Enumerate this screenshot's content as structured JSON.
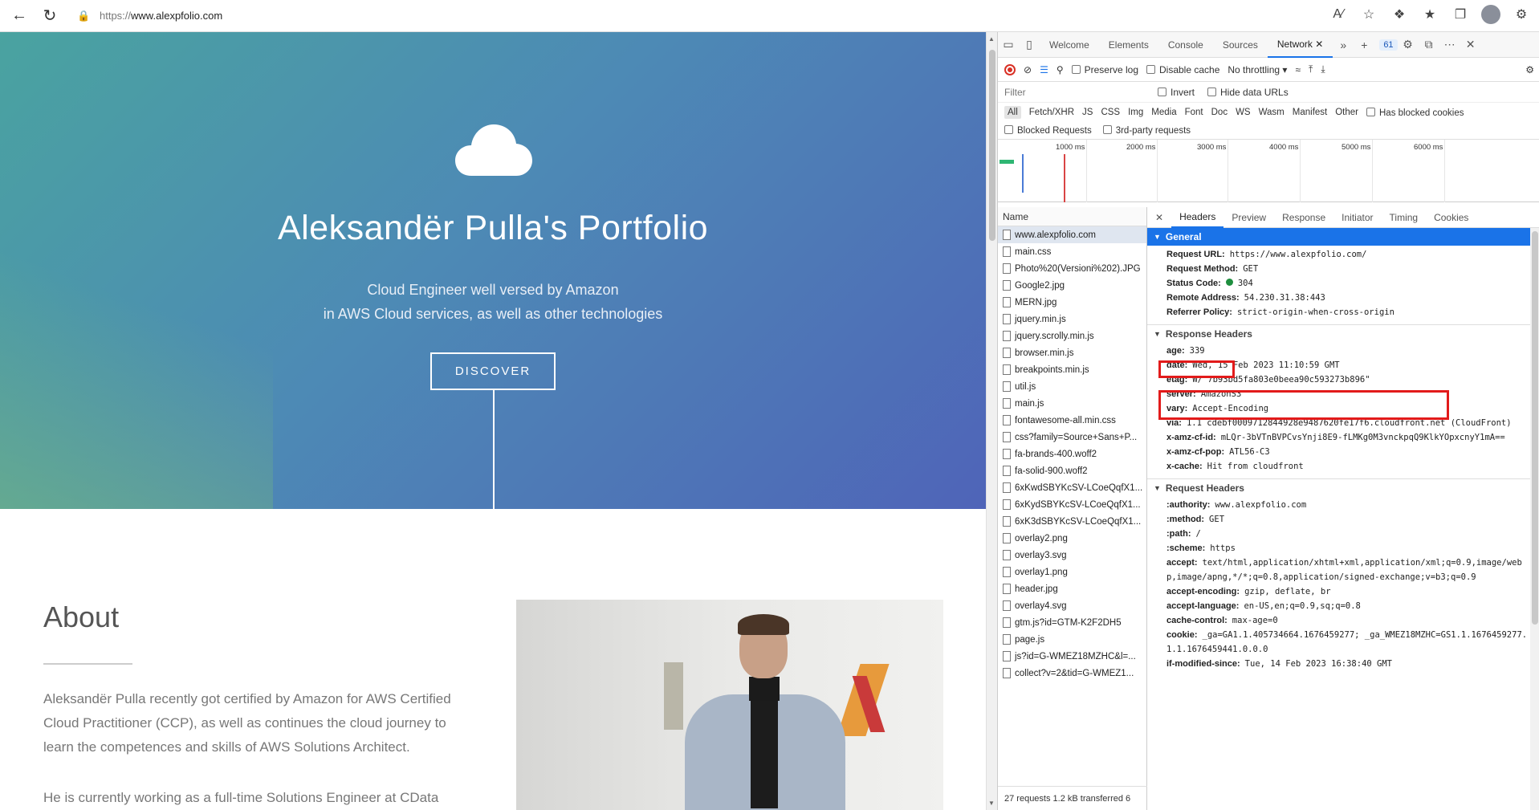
{
  "browser": {
    "url_prefix": "https://",
    "url_host": "www.alexpfolio.com"
  },
  "site": {
    "hero_title": "Aleksandër Pulla's Portfolio",
    "hero_sub_1": "Cloud Engineer well versed by Amazon",
    "hero_sub_2": "in AWS Cloud services, as well as other technologies",
    "discover_label": "DISCOVER",
    "about_title": "About",
    "about_p1": "Aleksandër Pulla recently got certified by Amazon for AWS Certified Cloud Practitioner (CCP), as well as continues the cloud journey to learn the competences and skills of AWS Solutions Architect.",
    "about_p2": "He is currently working as a full-time Solutions Engineer at CData"
  },
  "devtools": {
    "tabs": [
      "Welcome",
      "Elements",
      "Console",
      "Sources",
      "Network"
    ],
    "issues_count": "61",
    "preserve_log": "Preserve log",
    "disable_cache": "Disable cache",
    "throttling": "No throttling",
    "filter_placeholder": "Filter",
    "invert": "Invert",
    "hide_data_urls": "Hide data URLs",
    "types": [
      "All",
      "Fetch/XHR",
      "JS",
      "CSS",
      "Img",
      "Media",
      "Font",
      "Doc",
      "WS",
      "Wasm",
      "Manifest",
      "Other"
    ],
    "has_blocked_cookies": "Has blocked cookies",
    "blocked_requests": "Blocked Requests",
    "third_party": "3rd-party requests",
    "timeline_labels": [
      "1000 ms",
      "2000 ms",
      "3000 ms",
      "4000 ms",
      "5000 ms",
      "6000 ms"
    ],
    "name_header": "Name",
    "requests": [
      "www.alexpfolio.com",
      "main.css",
      "Photo%20(Versioni%202).JPG",
      "Google2.jpg",
      "MERN.jpg",
      "jquery.min.js",
      "jquery.scrolly.min.js",
      "browser.min.js",
      "breakpoints.min.js",
      "util.js",
      "main.js",
      "fontawesome-all.min.css",
      "css?family=Source+Sans+P...",
      "fa-brands-400.woff2",
      "fa-solid-900.woff2",
      "6xKwdSBYKcSV-LCoeQqfX1...",
      "6xKydSBYKcSV-LCoeQqfX1...",
      "6xK3dSBYKcSV-LCoeQqfX1...",
      "overlay2.png",
      "overlay3.svg",
      "overlay1.png",
      "header.jpg",
      "overlay4.svg",
      "gtm.js?id=GTM-K2F2DH5",
      "page.js",
      "js?id=G-WMEZ18MZHC&l=...",
      "collect?v=2&tid=G-WMEZ1..."
    ],
    "footer": "27 requests  1.2 kB transferred  6",
    "detail_tabs": [
      "Headers",
      "Preview",
      "Response",
      "Initiator",
      "Timing",
      "Cookies"
    ],
    "general_title": "General",
    "general": [
      {
        "k": "Request URL:",
        "v": "https://www.alexpfolio.com/"
      },
      {
        "k": "Request Method:",
        "v": "GET"
      },
      {
        "k": "Status Code:",
        "v": "304"
      },
      {
        "k": "Remote Address:",
        "v": "54.230.31.38:443"
      },
      {
        "k": "Referrer Policy:",
        "v": "strict-origin-when-cross-origin"
      }
    ],
    "response_title": "Response Headers",
    "response": [
      {
        "k": "age:",
        "v": "339"
      },
      {
        "k": "date:",
        "v": "Wed, 15 Feb 2023 11:10:59 GMT"
      },
      {
        "k": "etag:",
        "v": "W/\"7b93bd5fa803e0beea90c593273b896\""
      },
      {
        "k": "server:",
        "v": "AmazonS3"
      },
      {
        "k": "vary:",
        "v": "Accept-Encoding"
      },
      {
        "k": "via:",
        "v": "1.1 cdebf0009712844928e9487620fe17f6.cloudfront.net (CloudFront)"
      },
      {
        "k": "x-amz-cf-id:",
        "v": "mLQr-3bVTnBVPCvsYnji8E9-fLMKg0M3vnckpqQ9KlkYOpxcnyY1mA=="
      },
      {
        "k": "x-amz-cf-pop:",
        "v": "ATL56-C3"
      },
      {
        "k": "x-cache:",
        "v": "Hit from cloudfront"
      }
    ],
    "request_title": "Request Headers",
    "request": [
      {
        "k": ":authority:",
        "v": "www.alexpfolio.com"
      },
      {
        "k": ":method:",
        "v": "GET"
      },
      {
        "k": ":path:",
        "v": "/"
      },
      {
        "k": ":scheme:",
        "v": "https"
      },
      {
        "k": "accept:",
        "v": "text/html,application/xhtml+xml,application/xml;q=0.9,image/webp,image/apng,*/*;q=0.8,application/signed-exchange;v=b3;q=0.9"
      },
      {
        "k": "accept-encoding:",
        "v": "gzip, deflate, br"
      },
      {
        "k": "accept-language:",
        "v": "en-US,en;q=0.9,sq;q=0.8"
      },
      {
        "k": "cache-control:",
        "v": "max-age=0"
      },
      {
        "k": "cookie:",
        "v": "_ga=GA1.1.405734664.1676459277; _ga_WMEZ18MZHC=GS1.1.1676459277.1.1.1676459441.0.0.0"
      },
      {
        "k": "if-modified-since:",
        "v": "Tue, 14 Feb 2023 16:38:40 GMT"
      }
    ]
  }
}
